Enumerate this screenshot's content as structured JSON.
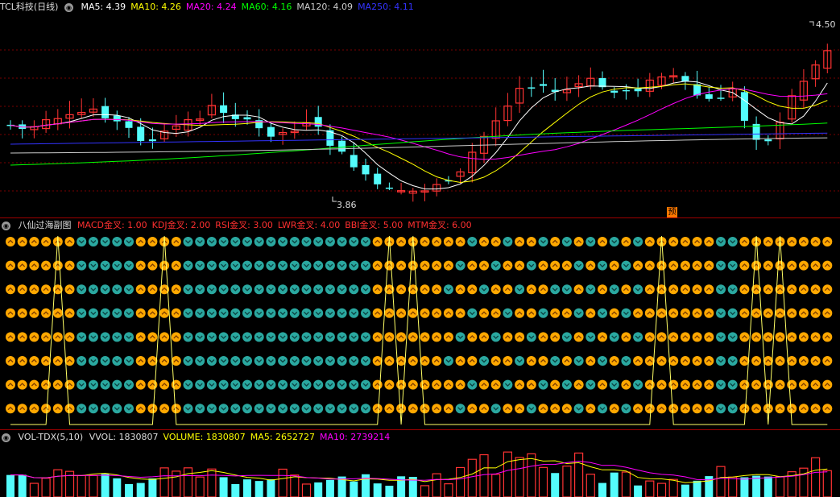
{
  "main": {
    "title": "TCL科技(日线)",
    "ma_labels": [
      {
        "text": "MA5: 4.39",
        "color": "#ffffff"
      },
      {
        "text": "MA10: 4.26",
        "color": "#ffff00"
      },
      {
        "text": "MA20: 4.24",
        "color": "#ff00ff"
      },
      {
        "text": "MA60: 4.16",
        "color": "#00ff00"
      },
      {
        "text": "MA120: 4.09",
        "color": "#cccccc"
      },
      {
        "text": "MA250: 4.11",
        "color": "#3333ff"
      }
    ],
    "high_label": "4.50",
    "low_label": "3.86",
    "marker": "预",
    "colors": {
      "up": "#ff3333",
      "down": "#54fcfc",
      "grid": "#7a0000"
    }
  },
  "indicator": {
    "title": "八仙过海副图",
    "items": [
      {
        "text": "MACD金叉: 1.00"
      },
      {
        "text": "KDJ金叉: 2.00"
      },
      {
        "text": "RSI金叉: 3.00"
      },
      {
        "text": "LWR金叉: 4.00"
      },
      {
        "text": "BBI金叉: 5.00"
      },
      {
        "text": "MTM金叉: 6.00"
      }
    ],
    "gold_color": "#ffa800",
    "teal_color": "#2aa8a0"
  },
  "volume": {
    "title": "VOL-TDX(5,10)",
    "items": [
      {
        "text": "VVOL: 1830807",
        "color": "#dddddd"
      },
      {
        "text": "VOLUME: 1830807",
        "color": "#ffff00"
      },
      {
        "text": "MA5: 2652727",
        "color": "#ffff00"
      },
      {
        "text": "MA10: 2739214",
        "color": "#ff00ff"
      }
    ]
  }
}
